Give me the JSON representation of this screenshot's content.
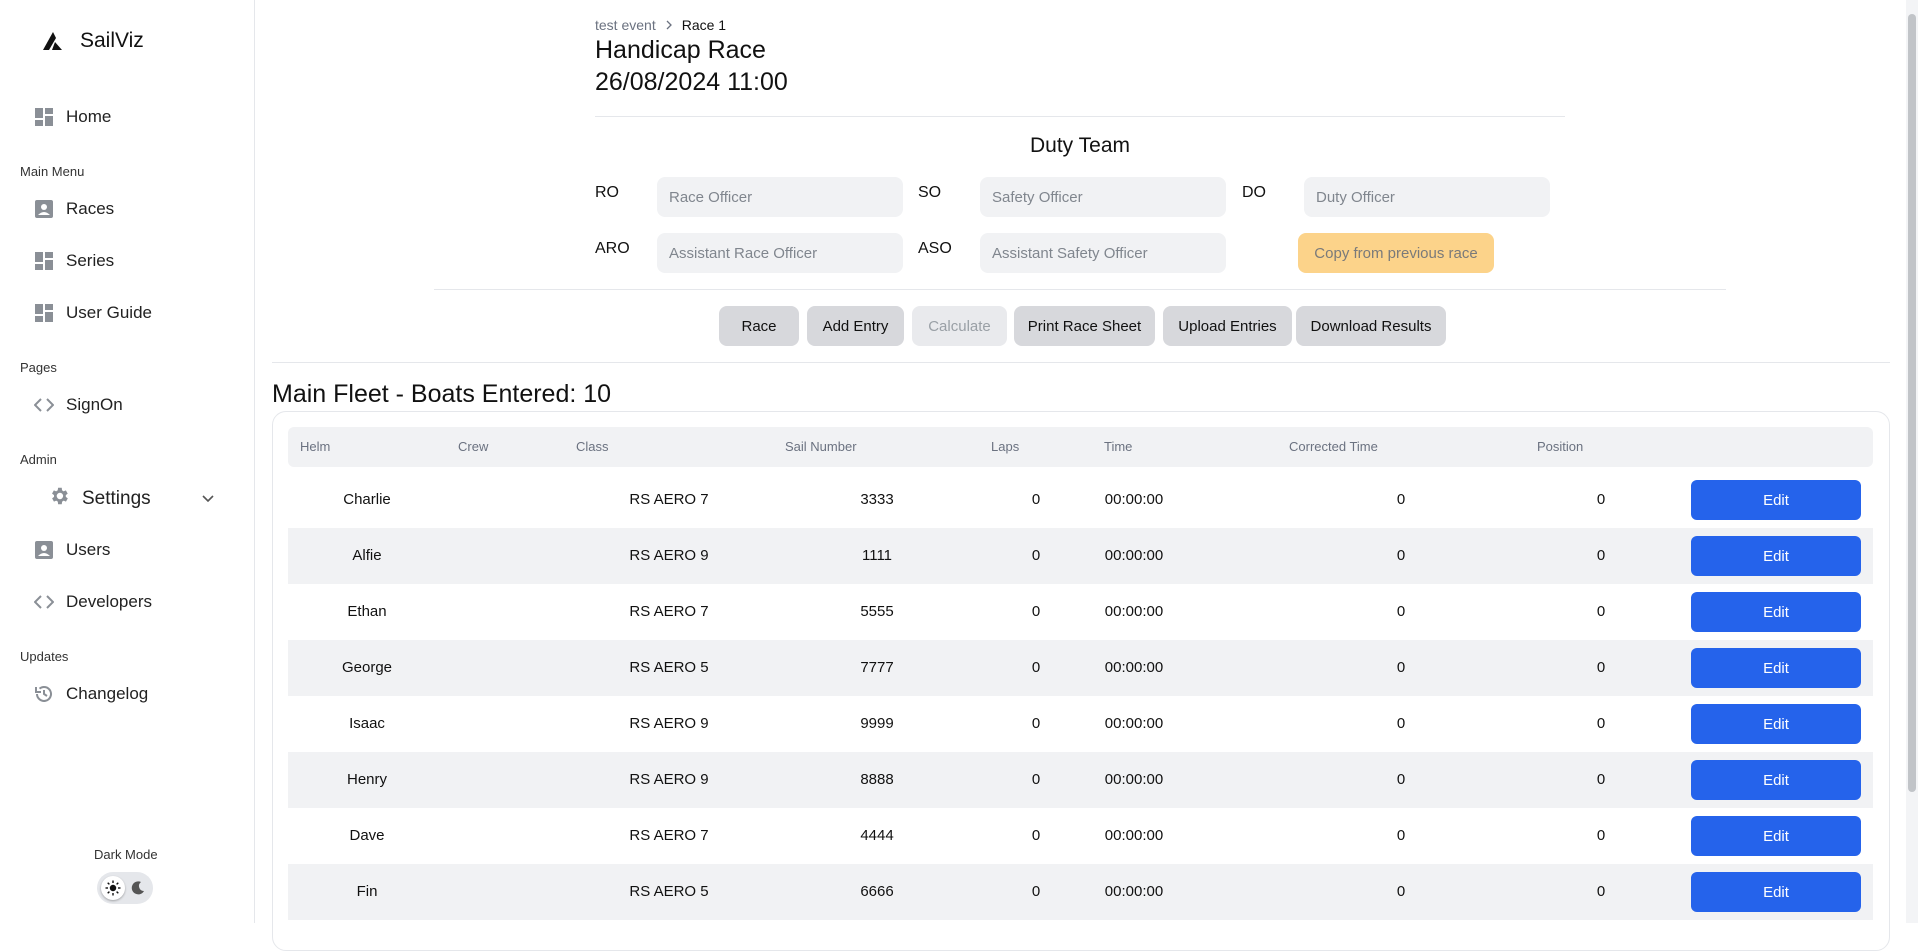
{
  "app": {
    "name": "SailViz"
  },
  "sidebar": {
    "home": "Home",
    "sections": {
      "main_menu": "Main Menu",
      "pages": "Pages",
      "admin": "Admin",
      "updates": "Updates"
    },
    "items": {
      "races": "Races",
      "series": "Series",
      "user_guide": "User Guide",
      "signon": "SignOn",
      "settings": "Settings",
      "users": "Users",
      "developers": "Developers",
      "changelog": "Changelog"
    },
    "dark_mode_label": "Dark Mode"
  },
  "breadcrumb": {
    "parent": "test event",
    "current": "Race 1"
  },
  "race": {
    "name": "Handicap Race",
    "datetime": "26/08/2024 11:00"
  },
  "duty_team": {
    "title": "Duty Team",
    "ro_label": "RO",
    "ro_placeholder": "Race Officer",
    "so_label": "SO",
    "so_placeholder": "Safety Officer",
    "do_label": "DO",
    "do_placeholder": "Duty Officer",
    "aro_label": "ARO",
    "aro_placeholder": "Assistant Race Officer",
    "aso_label": "ASO",
    "aso_placeholder": "Assistant Safety Officer",
    "copy_button": "Copy from previous race"
  },
  "actions": {
    "race": "Race",
    "add_entry": "Add Entry",
    "calculate": "Calculate",
    "print_race_sheet": "Print Race Sheet",
    "upload_entries": "Upload Entries",
    "download_results": "Download Results"
  },
  "fleet": {
    "title": "Main Fleet - Boats Entered: 10",
    "columns": {
      "helm": "Helm",
      "crew": "Crew",
      "class": "Class",
      "sail_number": "Sail Number",
      "laps": "Laps",
      "time": "Time",
      "corrected_time": "Corrected Time",
      "position": "Position"
    },
    "edit_label": "Edit",
    "rows": [
      {
        "helm": "Charlie",
        "crew": "",
        "class": "RS AERO 7",
        "sail_number": "3333",
        "laps": "0",
        "time": "00:00:00",
        "corrected_time": "0",
        "position": "0"
      },
      {
        "helm": "Alfie",
        "crew": "",
        "class": "RS AERO 9",
        "sail_number": "1111",
        "laps": "0",
        "time": "00:00:00",
        "corrected_time": "0",
        "position": "0"
      },
      {
        "helm": "Ethan",
        "crew": "",
        "class": "RS AERO 7",
        "sail_number": "5555",
        "laps": "0",
        "time": "00:00:00",
        "corrected_time": "0",
        "position": "0"
      },
      {
        "helm": "George",
        "crew": "",
        "class": "RS AERO 5",
        "sail_number": "7777",
        "laps": "0",
        "time": "00:00:00",
        "corrected_time": "0",
        "position": "0"
      },
      {
        "helm": "Isaac",
        "crew": "",
        "class": "RS AERO 9",
        "sail_number": "9999",
        "laps": "0",
        "time": "00:00:00",
        "corrected_time": "0",
        "position": "0"
      },
      {
        "helm": "Henry",
        "crew": "",
        "class": "RS AERO 9",
        "sail_number": "8888",
        "laps": "0",
        "time": "00:00:00",
        "corrected_time": "0",
        "position": "0"
      },
      {
        "helm": "Dave",
        "crew": "",
        "class": "RS AERO 7",
        "sail_number": "4444",
        "laps": "0",
        "time": "00:00:00",
        "corrected_time": "0",
        "position": "0"
      },
      {
        "helm": "Fin",
        "crew": "",
        "class": "RS AERO 5",
        "sail_number": "6666",
        "laps": "0",
        "time": "00:00:00",
        "corrected_time": "0",
        "position": "0"
      }
    ]
  },
  "colors": {
    "primary": "#2563eb",
    "warning": "#fcd38a",
    "surface": "#f1f2f4"
  }
}
